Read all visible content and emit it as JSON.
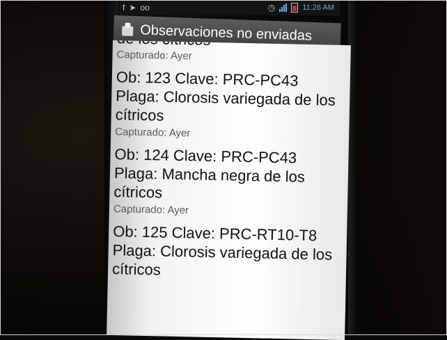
{
  "status_bar": {
    "left_icons": [
      "facebook-icon",
      "twitter-icon",
      "voicemail-icon"
    ],
    "right_icons": [
      "alarm-icon",
      "signal-icon",
      "battery-icon"
    ],
    "time": "11:26 AM"
  },
  "header": {
    "title": "Observaciones no enviadas"
  },
  "list": {
    "partial_top": {
      "plaga_continuation": "de los cítricos",
      "captured": "Capturado: Ayer"
    },
    "items": [
      {
        "header": "Ob: 123 Clave: PRC-PC43",
        "plaga": "Plaga: Clorosis variegada de los cítricos",
        "captured": "Capturado: Ayer"
      },
      {
        "header": "Ob: 124 Clave: PRC-PC43",
        "plaga": "Plaga: Mancha negra de los cítricos",
        "captured": "Capturado: Ayer"
      },
      {
        "header": "Ob: 125 Clave: PRC-RT10-T8",
        "plaga": "Plaga: Clorosis variegada de los cítricos",
        "captured": ""
      }
    ]
  }
}
